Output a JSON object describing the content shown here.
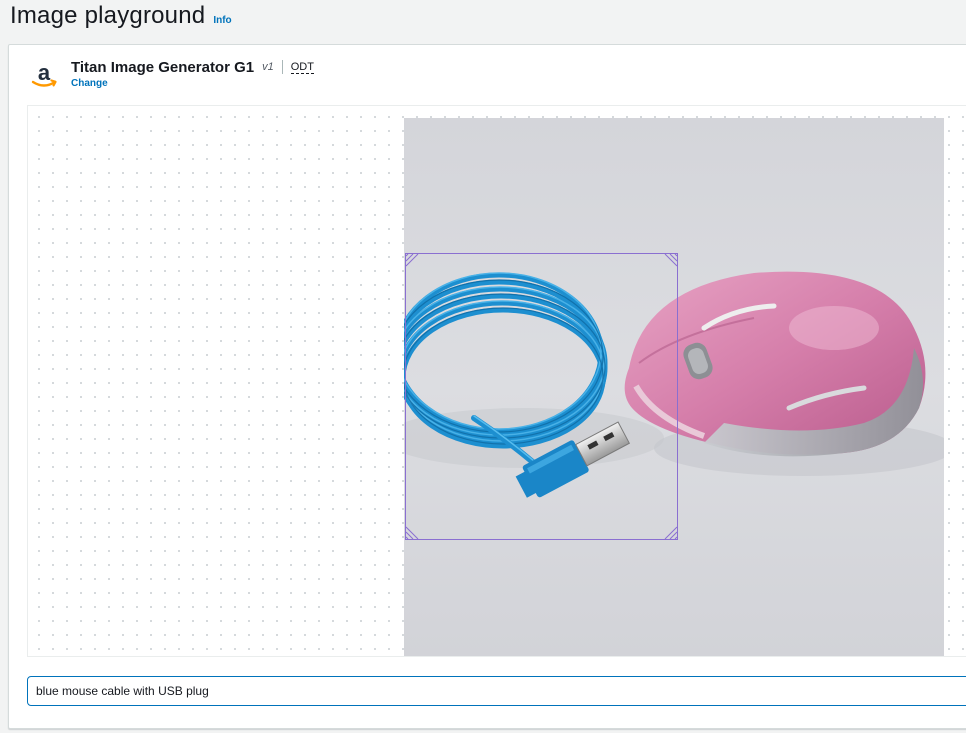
{
  "header": {
    "title": "Image playground",
    "info_label": "Info"
  },
  "model": {
    "name": "Titan Image Generator G1",
    "version": "v1",
    "tag": "ODT",
    "change_label": "Change",
    "logo_letter": "a"
  },
  "canvas": {
    "image": {
      "objects": [
        "blue cable with USB plug",
        "pink computer mouse"
      ]
    },
    "selection_color": "#8a6fd1"
  },
  "prompt": {
    "value": "blue mouse cable with USB plug"
  }
}
